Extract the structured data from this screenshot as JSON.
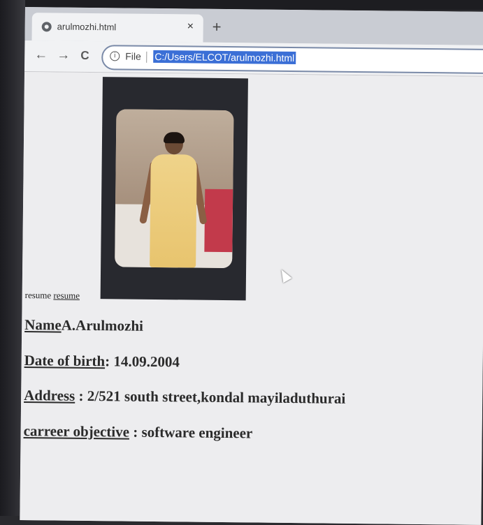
{
  "browser": {
    "tab_title": "arulmozhi.html",
    "close_symbol": "×",
    "new_tab_symbol": "+",
    "back_symbol": "←",
    "forward_symbol": "→",
    "reload_symbol": "C",
    "info_symbol": "i",
    "file_label": "File",
    "url": "C:/Users/ELCOT/arulmozhi.html"
  },
  "page": {
    "alt_text": "resume",
    "alt_link": "resume",
    "fields": [
      {
        "label": "Name",
        "separator": "",
        "value": "A.Arulmozhi"
      },
      {
        "label": "Date of birth",
        "separator": ": ",
        "value": "14.09.2004"
      },
      {
        "label": "Address",
        "separator": " : ",
        "value": "2/521 south street,kondal mayiladuthurai"
      },
      {
        "label": "carreer objective",
        "separator": " : ",
        "value": "software engineer"
      }
    ]
  },
  "colors": {
    "url_highlight": "#3b6fd6",
    "page_background": "#ededef",
    "text": "#2b2b2b"
  }
}
